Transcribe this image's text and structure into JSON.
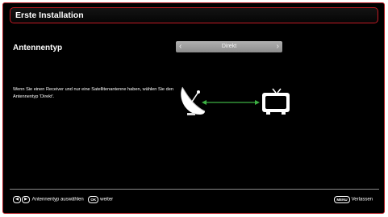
{
  "title": "Erste Installation",
  "antenna": {
    "label": "Antennentyp",
    "value": "Direkt",
    "left_arrow": "‹",
    "right_arrow": "›"
  },
  "description": "Wenn Sie einen Receiver und nur eine Satellitenantenne haben, wählen Sie den Antennentyp 'Direkt'.",
  "graphic": {
    "dish_icon": "satellite-dish-icon",
    "tv_icon": "tv-icon",
    "link_color": "#3cb043"
  },
  "footer": {
    "left_key": "◀",
    "right_key": "▶",
    "select_text": "Antennentyp auswählen",
    "ok_key": "OK",
    "ok_text": "weiter",
    "menu_key": "MENU",
    "menu_text": "Verlassen"
  },
  "colors": {
    "frame": "#b41a23",
    "background": "#000000",
    "selector": "#9a9a9a"
  }
}
